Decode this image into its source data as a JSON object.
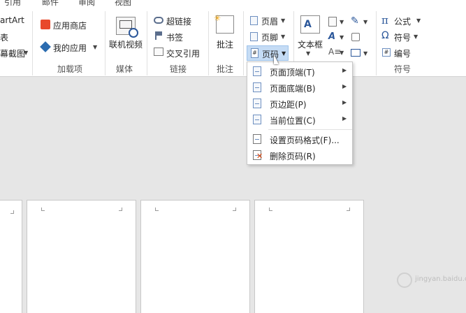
{
  "tabs": [
    "引用",
    "邮件",
    "审阅",
    "视图"
  ],
  "ribbon": {
    "left_partial": {
      "smartart": "artArt",
      "table": "表",
      "screenshot": "幕截图"
    },
    "addins": {
      "group_label": "加载项",
      "store": "应用商店",
      "myapps": "我的应用"
    },
    "media": {
      "group_label": "媒体",
      "online_video": "联机视频"
    },
    "links": {
      "group_label": "链接",
      "hyperlink": "超链接",
      "bookmark": "书签",
      "crossref": "交叉引用"
    },
    "comments": {
      "group_label": "批注",
      "comment": "批注"
    },
    "header_footer": {
      "header": "页眉",
      "footer": "页脚",
      "page_number": "页码"
    },
    "text": {
      "textbox": "文本框"
    },
    "symbols": {
      "group_label": "符号",
      "equation": "公式",
      "symbol": "符号",
      "number": "编号"
    }
  },
  "menu": {
    "items": [
      {
        "label": "页面顶端(T)",
        "submenu": true
      },
      {
        "label": "页面底端(B)",
        "submenu": true
      },
      {
        "label": "页边距(P)",
        "submenu": true
      },
      {
        "label": "当前位置(C)",
        "submenu": true
      },
      {
        "label": "设置页码格式(F)...",
        "submenu": false
      },
      {
        "label": "删除页码(R)",
        "submenu": false
      }
    ]
  },
  "watermark": "jingyan.baidu.com",
  "colors": {
    "ribbon_bg": "#ffffff",
    "doc_bg": "#e6e6e6",
    "accent_blue": "#2b579a",
    "selected_button_bg": "#c5dcf5",
    "red_delete": "#d83b01"
  }
}
